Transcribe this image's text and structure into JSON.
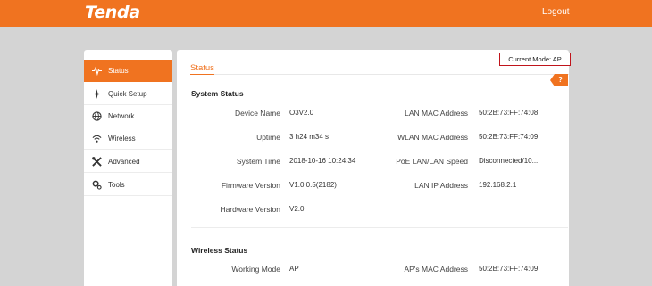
{
  "header": {
    "logo": "Tenda",
    "logout": "Logout"
  },
  "sidebar": {
    "items": [
      {
        "label": "Status",
        "icon": "pulse-icon"
      },
      {
        "label": "Quick Setup",
        "icon": "quick-setup-icon"
      },
      {
        "label": "Network",
        "icon": "globe-icon"
      },
      {
        "label": "Wireless",
        "icon": "wifi-icon"
      },
      {
        "label": "Advanced",
        "icon": "tools-icon"
      },
      {
        "label": "Tools",
        "icon": "gear-icon"
      }
    ]
  },
  "main": {
    "tab": "Status",
    "mode": "Current Mode: AP",
    "help": "?",
    "system_status": {
      "title": "System Status",
      "rows": [
        {
          "label": "Device Name",
          "value": "O3V2.0"
        },
        {
          "label": "Uptime",
          "value": "3 h24 m34 s"
        },
        {
          "label": "System Time",
          "value": "2018-10-16 10:24:34"
        },
        {
          "label": "Firmware Version",
          "value": "V1.0.0.5(2182)"
        },
        {
          "label": "Hardware Version",
          "value": "V2.0"
        }
      ],
      "rows_right": [
        {
          "label": "LAN MAC Address",
          "value": "50:2B:73:FF:74:08"
        },
        {
          "label": "WLAN MAC Address",
          "value": "50:2B:73:FF:74:09"
        },
        {
          "label": "PoE LAN/LAN Speed",
          "value": "Disconnected/10..."
        },
        {
          "label": "LAN IP Address",
          "value": "192.168.2.1"
        }
      ]
    },
    "wireless_status": {
      "title": "Wireless Status",
      "rows": [
        {
          "label": "Working Mode",
          "value": "AP"
        }
      ],
      "rows_right": [
        {
          "label": "AP's MAC Address",
          "value": "50:2B:73:FF:74:09"
        }
      ]
    }
  }
}
